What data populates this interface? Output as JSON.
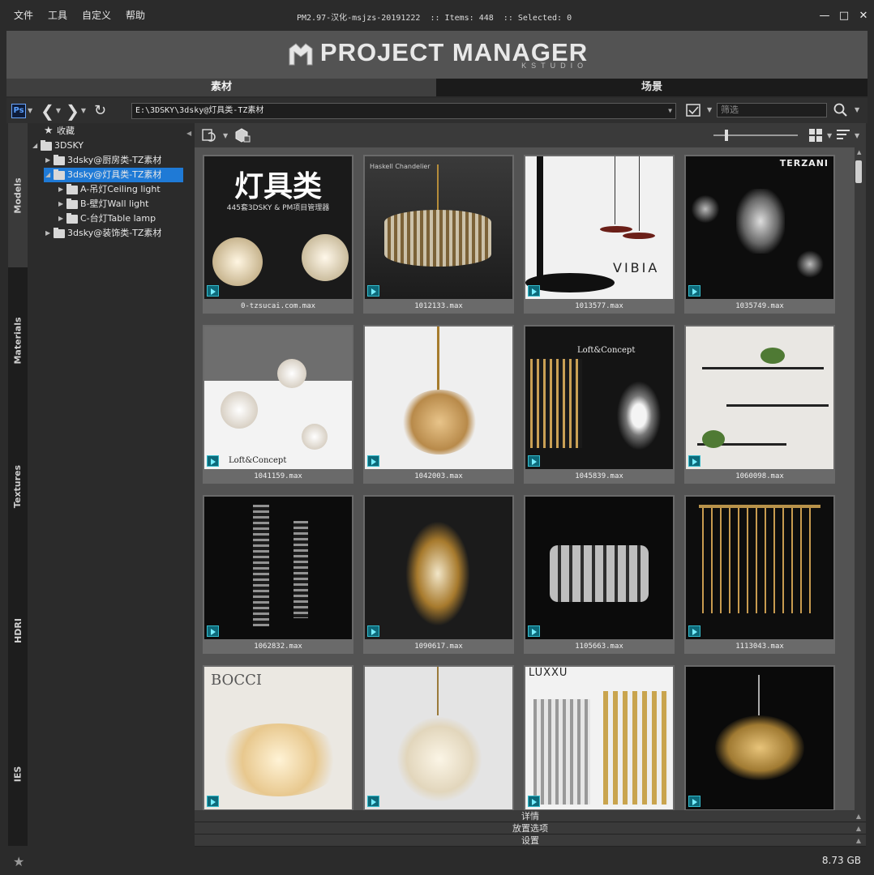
{
  "titlebar": {
    "menu": [
      "文件",
      "工具",
      "自定义",
      "帮助"
    ],
    "title": "PM2.97-汉化-msjzs-20191222  :: Items: 448  :: Selected: 0"
  },
  "banner": {
    "title": "PROJECT MANAGER",
    "subtitle": "KSTUDIO"
  },
  "tabs": [
    "素材",
    "场景"
  ],
  "toolbar": {
    "ps_label": "Ps",
    "path": "E:\\3DSKY\\3dsky@灯具类-TZ素材",
    "filter_placeholder": "筛选"
  },
  "sidebar_tabs": [
    "Models",
    "Materials",
    "Textures",
    "HDRI",
    "IES"
  ],
  "tree": {
    "favorites": "收藏",
    "root": "3DSKY",
    "items": [
      "3dsky@厨房类-TZ素材",
      "3dsky@灯具类-TZ素材",
      "A-吊灯Ceiling light",
      "B-壁灯Wall light",
      "C-台灯Table lamp",
      "3dsky@装饰类-TZ素材"
    ]
  },
  "cards": [
    {
      "label": "0-tzsucai.com.max",
      "overlay": "灯具类",
      "overlay_sub": "445套3DSKY & PM项目管理器"
    },
    {
      "label": "1012133.max",
      "overlay": "Haskell Chandelier"
    },
    {
      "label": "1013577.max",
      "overlay": "VIBIA"
    },
    {
      "label": "1035749.max",
      "overlay": "TERZANI"
    },
    {
      "label": "1041159.max",
      "overlay": "Loft&Concept"
    },
    {
      "label": "1042003.max",
      "overlay": ""
    },
    {
      "label": "1045839.max",
      "overlay": "Loft&Concept"
    },
    {
      "label": "1060098.max",
      "overlay": ""
    },
    {
      "label": "1062832.max",
      "overlay": ""
    },
    {
      "label": "1090617.max",
      "overlay": ""
    },
    {
      "label": "1105663.max",
      "overlay": ""
    },
    {
      "label": "1113043.max",
      "overlay": ""
    },
    {
      "label": "",
      "overlay": "BOCCI"
    },
    {
      "label": "",
      "overlay": ""
    },
    {
      "label": "",
      "overlay": "LUXXU"
    },
    {
      "label": "",
      "overlay": ""
    }
  ],
  "bottom_panels": [
    "详情",
    "放置选项",
    "设置"
  ],
  "status": {
    "size": "8.73 GB"
  }
}
